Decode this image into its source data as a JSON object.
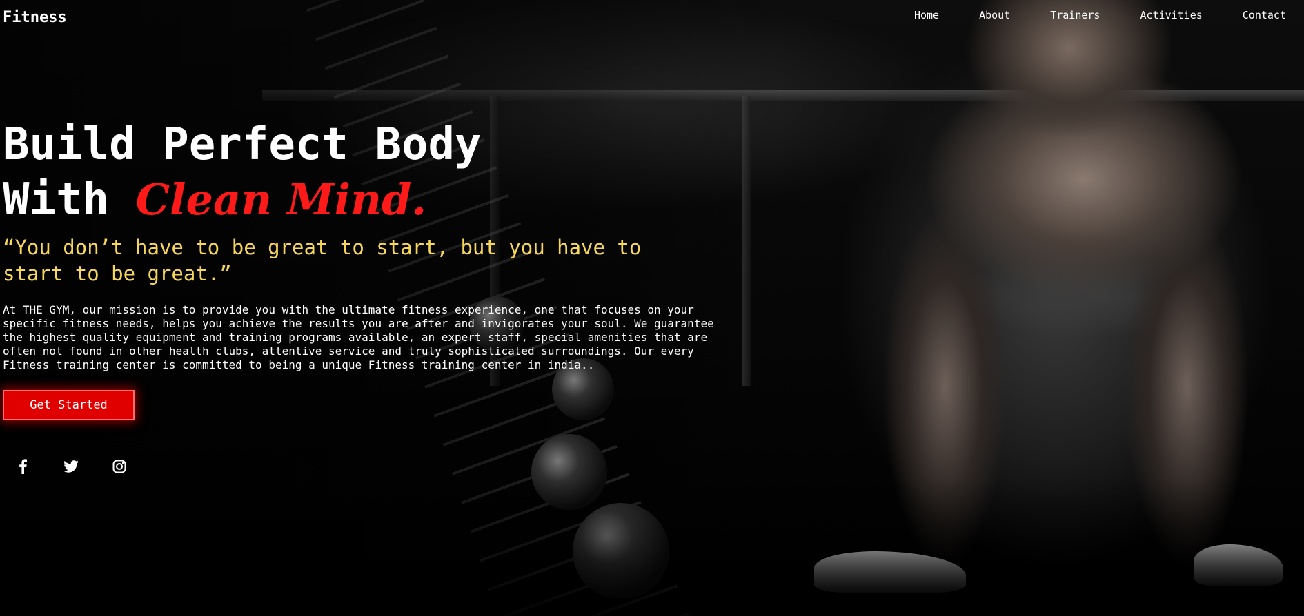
{
  "header": {
    "logo": "Fitness",
    "nav": [
      "Home",
      "About",
      "Trainers",
      "Activities",
      "Contact"
    ]
  },
  "hero": {
    "title_line1": "Build Perfect Body",
    "title_line2_prefix": "With ",
    "title_line2_accent": "Clean Mind.",
    "quote": "“You don’t have to be great to start, but you have to start to be great.”",
    "description": "At THE GYM, our mission is to provide you with the ultimate fitness experience, one that focuses on your specific fitness needs, helps you achieve the results you are after and invigorates your soul. We guarantee the highest quality equipment and training programs available, an expert staff, special amenities that are often not found in other health clubs, attentive service and truly sophisticated surroundings. Our every Fitness training center is committed to being a unique Fitness training center in india..",
    "cta_label": "Get Started"
  },
  "social": {
    "icons": [
      "facebook-icon",
      "twitter-icon",
      "instagram-icon"
    ]
  },
  "colors": {
    "accent_red": "#ff1a1a",
    "quote_yellow": "#f7d75a",
    "button_red": "#e00000"
  }
}
